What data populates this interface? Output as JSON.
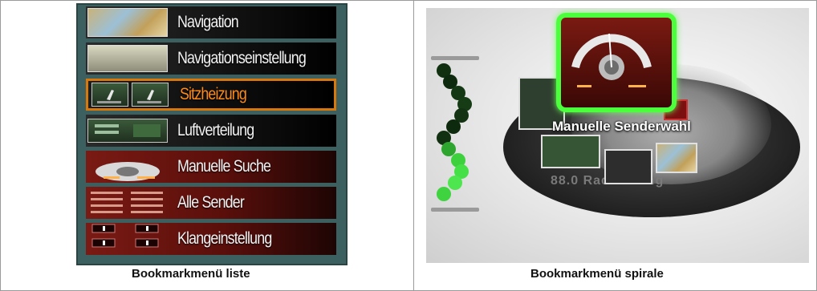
{
  "left": {
    "caption": "Bookmarkmenü liste",
    "menu_items": [
      {
        "label": "Navigation"
      },
      {
        "label": "Navigationseinstellung"
      },
      {
        "label": "Sitzheizung"
      },
      {
        "label": "Luftverteilung"
      },
      {
        "label": "Manuelle Suche"
      },
      {
        "label": "Alle Sender"
      },
      {
        "label": "Klangeinstellung"
      }
    ],
    "selected_index": 2,
    "selected_color": "#ff8a14"
  },
  "right": {
    "caption": "Bookmarkmenü spirale",
    "focused_label": "Manuelle Senderwahl",
    "background_text": "88.0 Radio Gong",
    "highlight_color": "#4cff3c"
  }
}
